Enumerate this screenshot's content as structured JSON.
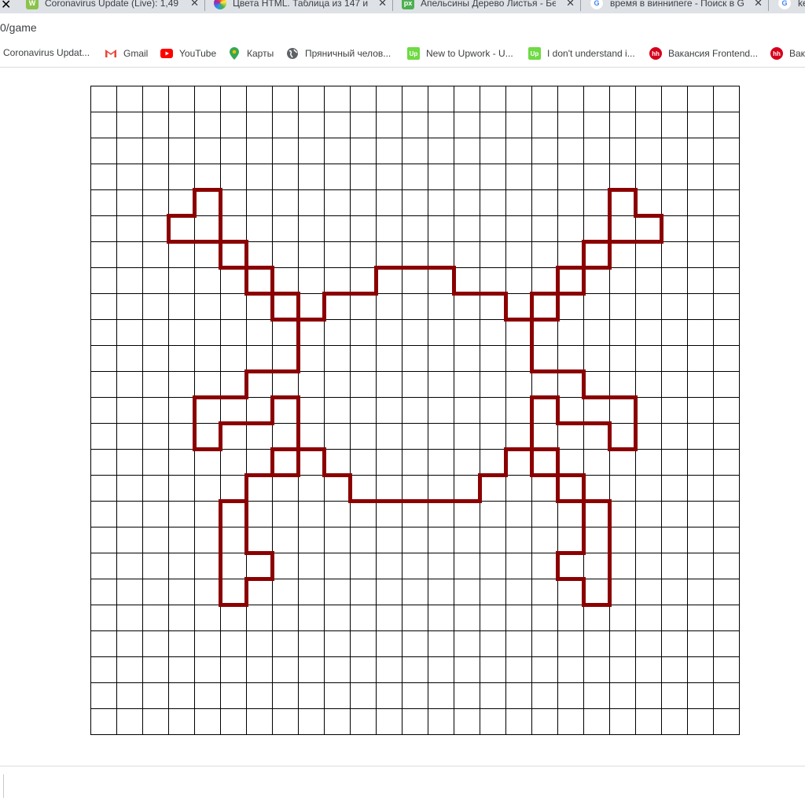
{
  "browser": {
    "tabs": [
      {
        "title": "Coronavirus Update (Live): 1,49",
        "icon": "worldometer-icon",
        "color": "#8bc34a"
      },
      {
        "title": "Цвета HTML. Таблица из 147 им",
        "icon": "color-wheel-icon",
        "color": "#ff9800"
      },
      {
        "title": "Апельсины Дерево Листья - Бе",
        "icon": "pixabay-icon",
        "color": "#4caf50"
      },
      {
        "title": "время в виннипеге - Поиск в G",
        "icon": "google-icon",
        "color": "#4285f4"
      },
      {
        "title": "ke",
        "icon": "google-icon",
        "color": "#4285f4"
      }
    ],
    "url": "0/game",
    "bookmarks": [
      {
        "label": "Coronavirus Updat...",
        "icon": "none"
      },
      {
        "label": "Gmail",
        "icon": "gmail-icon"
      },
      {
        "label": "YouTube",
        "icon": "youtube-icon"
      },
      {
        "label": "Карты",
        "icon": "maps-icon"
      },
      {
        "label": "Пряничный челов...",
        "icon": "globe-icon"
      },
      {
        "label": "New to Upwork - U...",
        "icon": "upwork-icon"
      },
      {
        "label": "I don't understand i...",
        "icon": "upwork-icon"
      },
      {
        "label": "Вакансия Frontend...",
        "icon": "hh-icon"
      },
      {
        "label": "Вак",
        "icon": "hh-icon"
      }
    ]
  },
  "game": {
    "cols": 25,
    "rows": 25,
    "grid_color": "#000000",
    "path_color": "#8b0000",
    "paths": [
      [
        [
          4,
          5
        ],
        [
          4,
          4
        ],
        [
          5,
          4
        ],
        [
          5,
          6
        ],
        [
          6,
          6
        ],
        [
          6,
          7
        ],
        [
          7,
          7
        ],
        [
          7,
          8
        ],
        [
          8,
          8
        ],
        [
          8,
          9
        ],
        [
          9,
          9
        ],
        [
          9,
          8
        ],
        [
          11,
          8
        ],
        [
          11,
          7
        ],
        [
          14,
          7
        ],
        [
          14,
          8
        ],
        [
          16,
          8
        ],
        [
          16,
          9
        ],
        [
          18,
          9
        ],
        [
          18,
          8
        ],
        [
          19,
          8
        ],
        [
          19,
          7
        ],
        [
          20,
          7
        ],
        [
          20,
          6
        ],
        [
          22,
          6
        ],
        [
          22,
          5
        ],
        [
          21,
          5
        ],
        [
          21,
          4
        ],
        [
          20,
          4
        ],
        [
          20,
          6
        ],
        [
          19,
          6
        ],
        [
          19,
          7
        ],
        [
          18,
          7
        ],
        [
          18,
          8
        ],
        [
          17,
          8
        ],
        [
          17,
          11
        ],
        [
          19,
          11
        ],
        [
          19,
          12
        ],
        [
          21,
          12
        ],
        [
          21,
          14
        ],
        [
          20,
          14
        ],
        [
          20,
          13
        ],
        [
          18,
          13
        ],
        [
          18,
          12
        ],
        [
          17,
          12
        ],
        [
          17,
          14
        ],
        [
          16,
          14
        ],
        [
          16,
          15
        ],
        [
          15,
          15
        ],
        [
          15,
          16
        ],
        [
          10,
          16
        ],
        [
          10,
          15
        ],
        [
          9,
          15
        ],
        [
          9,
          14
        ],
        [
          7,
          14
        ],
        [
          7,
          15
        ],
        [
          6,
          15
        ],
        [
          6,
          16
        ],
        [
          5,
          16
        ],
        [
          5,
          20
        ],
        [
          6,
          20
        ],
        [
          6,
          19
        ],
        [
          7,
          19
        ],
        [
          7,
          18
        ],
        [
          6,
          18
        ],
        [
          6,
          15
        ],
        [
          8,
          15
        ],
        [
          8,
          12
        ],
        [
          7,
          12
        ],
        [
          7,
          13
        ],
        [
          5,
          13
        ],
        [
          5,
          14
        ],
        [
          4,
          14
        ],
        [
          4,
          12
        ],
        [
          6,
          12
        ],
        [
          6,
          11
        ],
        [
          8,
          11
        ],
        [
          8,
          9
        ],
        [
          7,
          9
        ],
        [
          7,
          8
        ],
        [
          6,
          8
        ],
        [
          6,
          7
        ],
        [
          5,
          7
        ],
        [
          5,
          6
        ],
        [
          3,
          6
        ],
        [
          3,
          5
        ],
        [
          4,
          5
        ]
      ],
      [
        [
          17,
          14
        ],
        [
          17,
          15
        ],
        [
          18,
          15
        ],
        [
          18,
          16
        ],
        [
          19,
          16
        ],
        [
          19,
          18
        ],
        [
          18,
          18
        ],
        [
          18,
          19
        ],
        [
          19,
          19
        ],
        [
          19,
          20
        ],
        [
          20,
          20
        ],
        [
          20,
          16
        ],
        [
          19,
          16
        ],
        [
          19,
          15
        ],
        [
          18,
          15
        ],
        [
          18,
          14
        ],
        [
          17,
          14
        ]
      ]
    ]
  }
}
